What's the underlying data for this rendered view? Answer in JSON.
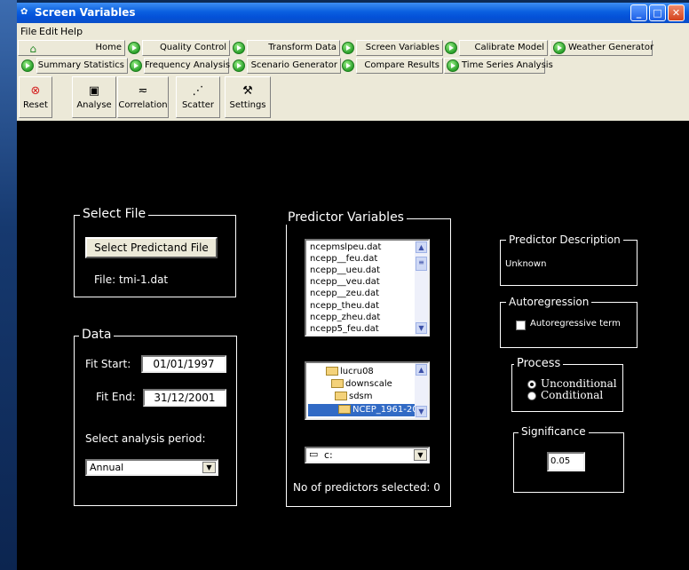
{
  "window": {
    "title": "Screen Variables"
  },
  "menu": [
    "File",
    "Edit",
    "Help"
  ],
  "nav_row1": [
    "Home",
    "Quality Control",
    "Transform Data",
    "Screen Variables",
    "Calibrate Model",
    "Weather Generator"
  ],
  "nav_row2": [
    "Summary Statistics",
    "Frequency Analysis",
    "Scenario Generator",
    "Compare Results",
    "Time Series Analysis"
  ],
  "toolbar": [
    {
      "label": "Reset",
      "icon": "reset-icon"
    },
    {
      "label": "Analyse",
      "icon": "analyse-icon"
    },
    {
      "label": "Correlation",
      "icon": "correlation-icon"
    },
    {
      "label": "Scatter",
      "icon": "scatter-icon"
    },
    {
      "label": "Settings",
      "icon": "settings-icon"
    }
  ],
  "select_file": {
    "title": "Select File",
    "button": "Select Predictand File",
    "file_label": "File:",
    "file_value": "tmi-1.dat"
  },
  "data": {
    "title": "Data",
    "fit_start_label": "Fit Start:",
    "fit_start": "01/01/1997",
    "fit_end_label": "Fit End:",
    "fit_end": "31/12/2001",
    "period_label": "Select analysis period:",
    "period": "Annual"
  },
  "predictors": {
    "title": "Predictor Variables",
    "items": [
      "ncepmslpeu.dat",
      "ncepp__feu.dat",
      "ncepp__ueu.dat",
      "ncepp__veu.dat",
      "ncepp__zeu.dat",
      "ncepp_theu.dat",
      "ncepp_zheu.dat",
      "ncepp5_feu.dat"
    ],
    "folders": [
      "lucru08",
      "downscale",
      "sdsm",
      "NCEP_1961-20("
    ],
    "drive": "c:",
    "count_label": "No of predictors selected: 0"
  },
  "description": {
    "title": "Predictor Description",
    "value": "Unknown"
  },
  "autoregression": {
    "title": "Autoregression",
    "checkbox": "Autoregressive term"
  },
  "process": {
    "title": "Process",
    "option1": "Unconditional",
    "option2": "Conditional"
  },
  "significance": {
    "title": "Significance",
    "value": "0.05"
  }
}
